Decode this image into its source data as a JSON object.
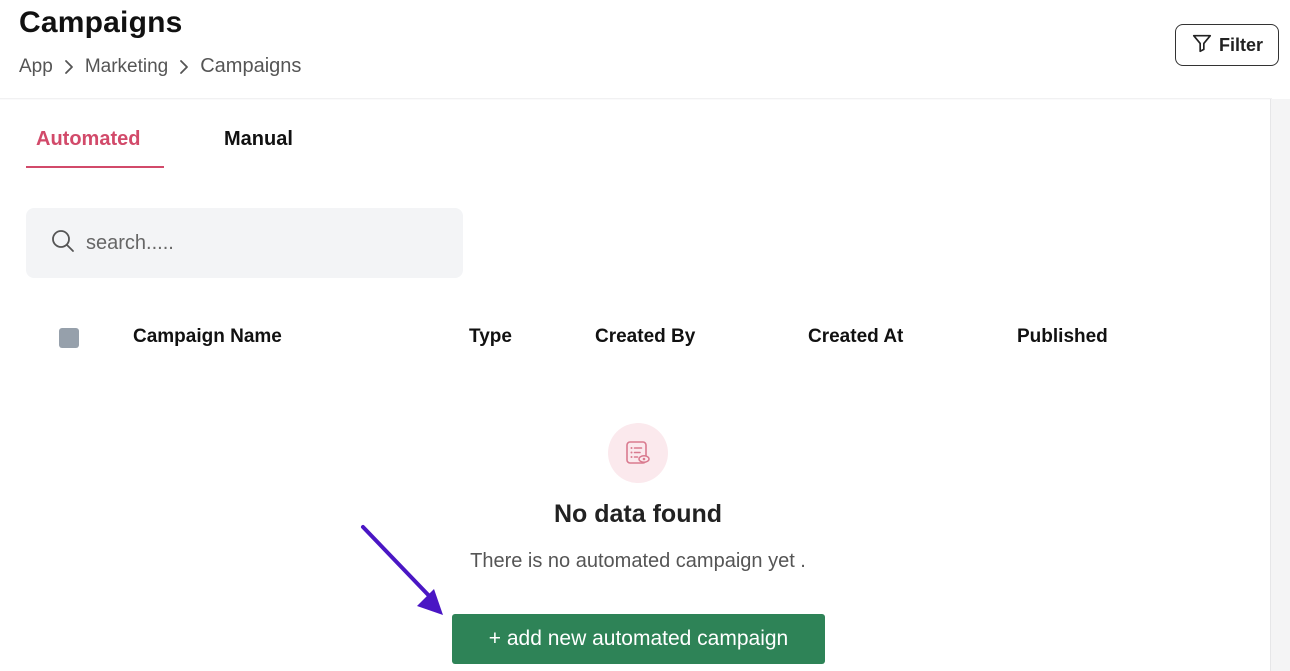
{
  "header": {
    "title": "Campaigns",
    "breadcrumb": [
      "App",
      "Marketing",
      "Campaigns"
    ],
    "filter_label": "Filter"
  },
  "tabs": [
    {
      "label": "Automated",
      "active": true
    },
    {
      "label": "Manual",
      "active": false
    }
  ],
  "search": {
    "placeholder": "search.....",
    "value": ""
  },
  "table": {
    "columns": [
      "Campaign Name",
      "Type",
      "Created By",
      "Created At",
      "Published"
    ],
    "rows": []
  },
  "empty_state": {
    "title": "No data found",
    "message": "There is no automated campaign yet .",
    "action_label": "+ add new automated campaign",
    "icon": "list-view-icon"
  },
  "annotation": {
    "icon": "arrow-pointer-icon",
    "color": "#4a16c4"
  },
  "colors": {
    "accent": "#d24a6a",
    "primary_button": "#2e8357",
    "search_bg": "#f3f4f6"
  }
}
